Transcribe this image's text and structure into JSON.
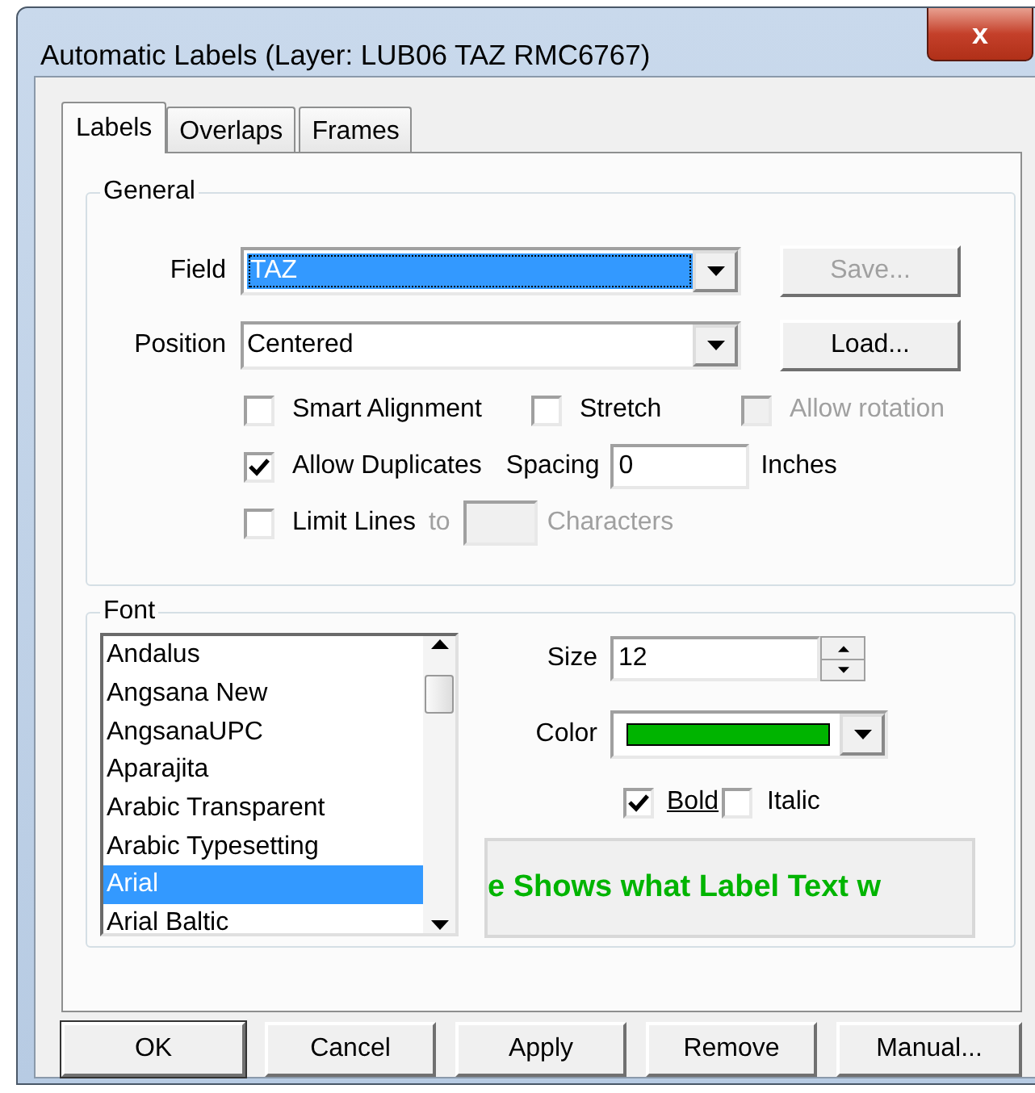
{
  "window": {
    "title": "Automatic Labels (Layer: LUB06 TAZ RMC6767)",
    "close": "x"
  },
  "tabs": [
    {
      "label": "Labels",
      "selected": true
    },
    {
      "label": "Overlaps",
      "selected": false
    },
    {
      "label": "Frames",
      "selected": false
    }
  ],
  "general": {
    "title": "General",
    "field": {
      "label": "Field",
      "value": "TAZ",
      "focused": true
    },
    "position": {
      "label": "Position",
      "value": "Centered",
      "focused": false
    },
    "save_button": {
      "label": "Save...",
      "disabled": true
    },
    "load_button": {
      "label": "Load...",
      "disabled": false
    },
    "options": [
      {
        "label": "Smart Alignment",
        "checked": false,
        "disabled": false
      },
      {
        "label": "Stretch",
        "checked": false,
        "disabled": false
      },
      {
        "label": "Allow rotation",
        "checked": false,
        "disabled": true
      }
    ],
    "duplicates": {
      "label": "Allow Duplicates",
      "checked": true,
      "spacing_label": "Spacing",
      "spacing_value": "0",
      "unit": "Inches"
    },
    "limit_lines": {
      "label": "Limit Lines",
      "checked": false,
      "to_label": "to",
      "unit": "Characters",
      "disabled": true
    }
  },
  "font": {
    "title": "Font",
    "fonts": [
      {
        "name": "Andalus",
        "selected": false
      },
      {
        "name": "Angsana New",
        "selected": false
      },
      {
        "name": "AngsanaUPC",
        "selected": false
      },
      {
        "name": "Aparajita",
        "selected": false
      },
      {
        "name": "Arabic Transparent",
        "selected": false
      },
      {
        "name": "Arabic Typesetting",
        "selected": false
      },
      {
        "name": "Arial",
        "selected": true
      },
      {
        "name": "Arial Baltic",
        "selected": false
      }
    ],
    "size_label": "Size",
    "size": "12",
    "color_label": "Color",
    "color": "#00b400",
    "bold": {
      "label": "Bold",
      "checked": true
    },
    "italic": {
      "label": "Italic",
      "checked": false
    },
    "preview": "e Shows what Label Text w"
  },
  "buttons": [
    {
      "label": "OK",
      "default": true
    },
    {
      "label": "Cancel",
      "default": false
    },
    {
      "label": "Apply",
      "default": false
    },
    {
      "label": "Remove",
      "default": false
    },
    {
      "label": "Manual...",
      "default": false
    }
  ]
}
